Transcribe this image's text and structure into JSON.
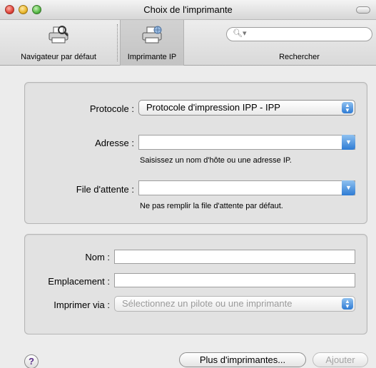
{
  "window": {
    "title": "Choix de l'imprimante"
  },
  "toolbar": {
    "default_browser": {
      "label": "Navigateur par défaut",
      "icon": "printer-browser-icon"
    },
    "ip_printer": {
      "label": "Imprimante IP",
      "icon": "ip-printer-icon"
    },
    "search": {
      "placeholder": "",
      "label": "Rechercher",
      "icon": "search-icon"
    }
  },
  "ip_panel": {
    "protocol": {
      "label": "Protocole :",
      "value": "Protocole d'impression IPP - IPP"
    },
    "address": {
      "label": "Adresse :",
      "value": "",
      "hint": "Saisissez un nom d'hôte ou une adresse IP."
    },
    "queue": {
      "label": "File d'attente :",
      "value": "",
      "hint": "Ne pas remplir la file d'attente par défaut."
    }
  },
  "details_panel": {
    "name": {
      "label": "Nom :",
      "value": ""
    },
    "location": {
      "label": "Emplacement :",
      "value": ""
    },
    "print_using": {
      "label": "Imprimer via :",
      "value": "Sélectionnez un pilote ou une imprimante"
    }
  },
  "footer": {
    "help": "?",
    "more_printers": "Plus d'imprimantes...",
    "add": "Ajouter"
  },
  "colors": {
    "accent": "#2e7bd4",
    "window_bg": "#ececec",
    "panel_bg": "#e2e2e2"
  }
}
